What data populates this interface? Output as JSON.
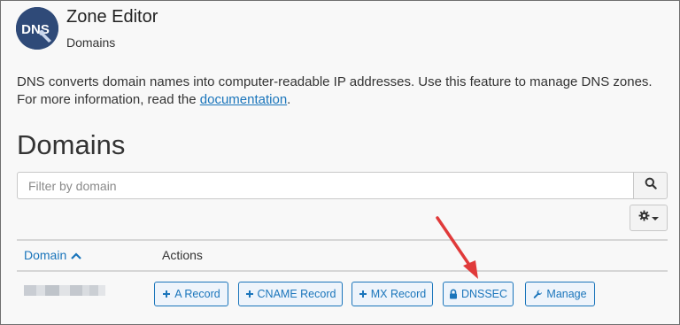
{
  "header": {
    "logo_text": "DNS",
    "title": "Zone Editor",
    "breadcrumb": "Domains"
  },
  "intro": {
    "text_before": "DNS converts domain names into computer-readable IP addresses. Use this feature to manage DNS zones. For more information, read the ",
    "link_text": "documentation",
    "text_after": "."
  },
  "page_heading": "Domains",
  "filter": {
    "placeholder": "Filter by domain",
    "search_icon": "search-icon",
    "settings_icon": "gear-icon"
  },
  "table": {
    "columns": {
      "domain": "Domain",
      "actions": "Actions"
    },
    "sort_icon": "chevron-up-icon",
    "rows": [
      {
        "domain": "",
        "actions": [
          {
            "label": "A Record",
            "icon": "plus-icon"
          },
          {
            "label": "CNAME Record",
            "icon": "plus-icon"
          },
          {
            "label": "MX Record",
            "icon": "plus-icon"
          },
          {
            "label": "DNSSEC",
            "icon": "lock-icon"
          },
          {
            "label": "Manage",
            "icon": "wrench-icon"
          }
        ]
      }
    ]
  },
  "colors": {
    "accent": "#1a75bb",
    "annotation": "#e03a3a",
    "logo_bg": "#2f4a78"
  }
}
